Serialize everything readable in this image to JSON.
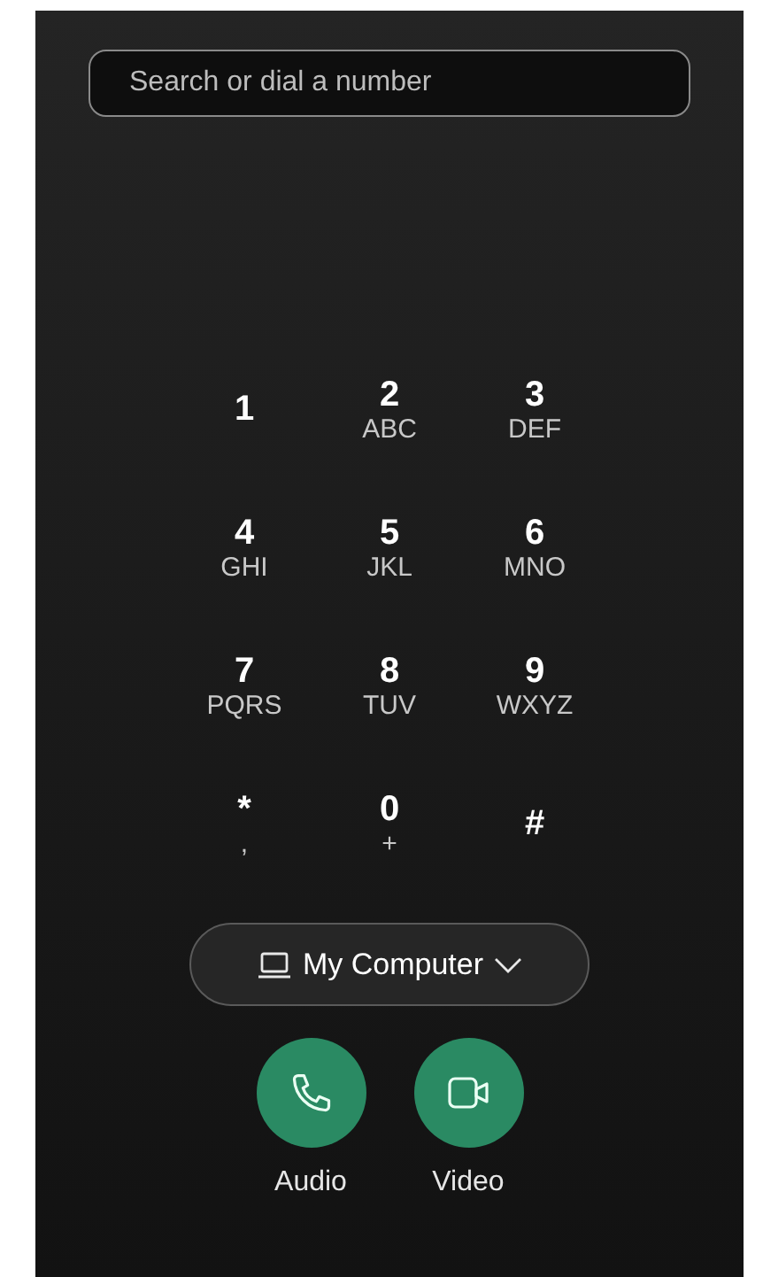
{
  "search": {
    "placeholder": "Search or dial a number"
  },
  "keypad": [
    {
      "digit": "1"
    },
    {
      "digit": "2",
      "letters": "ABC"
    },
    {
      "digit": "3",
      "letters": "DEF"
    },
    {
      "digit": "4",
      "letters": "GHI"
    },
    {
      "digit": "5",
      "letters": "JKL"
    },
    {
      "digit": "6",
      "letters": "MNO"
    },
    {
      "digit": "7",
      "letters": "PQRS"
    },
    {
      "digit": "8",
      "letters": "TUV"
    },
    {
      "digit": "9",
      "letters": "WXYZ"
    },
    {
      "digit": "*",
      "letters": ","
    },
    {
      "digit": "0",
      "letters": "+"
    },
    {
      "digit": "#"
    }
  ],
  "device_selector": {
    "label": "My Computer"
  },
  "call_buttons": [
    {
      "kind": "audio",
      "label": "Audio"
    },
    {
      "kind": "video",
      "label": "Video"
    }
  ]
}
